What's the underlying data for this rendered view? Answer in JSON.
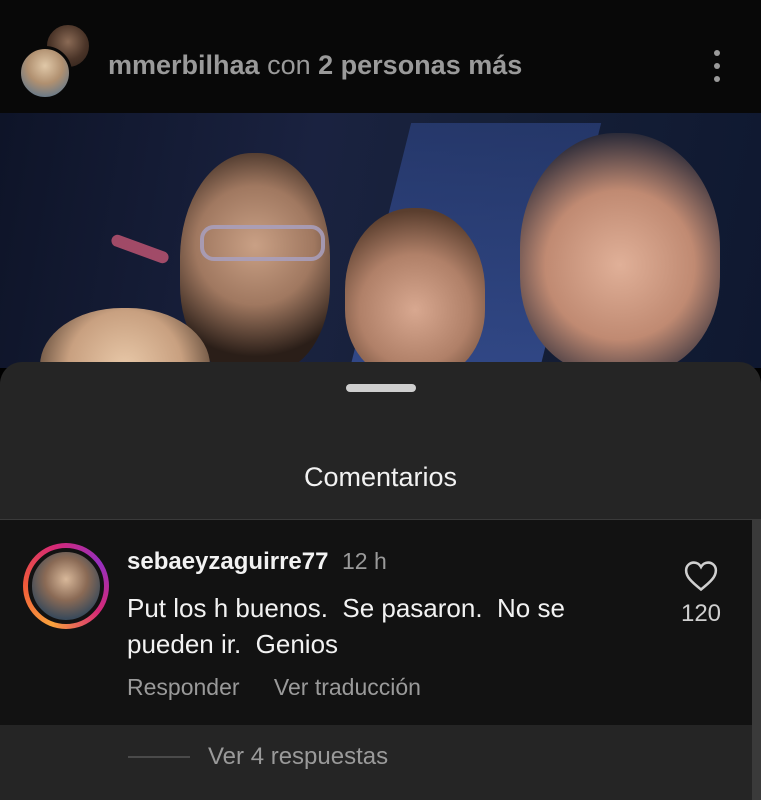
{
  "header": {
    "username": "mmerbilhaa",
    "with_text": "con",
    "others": "2 personas más",
    "more_icon": "more-vertical-icon"
  },
  "sheet": {
    "title": "Comentarios"
  },
  "comment": {
    "username": "sebaeyzaguirre77",
    "time": "12 h",
    "text": "Put los h buenos.  Se pasaron.  No se\npueden ir.  Genios",
    "like_count": "120",
    "reply_label": "Responder",
    "translate_label": "Ver traducción"
  },
  "replies": {
    "label": "Ver 4 respuestas"
  },
  "colors": {
    "sheet_bg": "#252525",
    "comment_bg": "#121212",
    "story_ring": "#d62976"
  }
}
